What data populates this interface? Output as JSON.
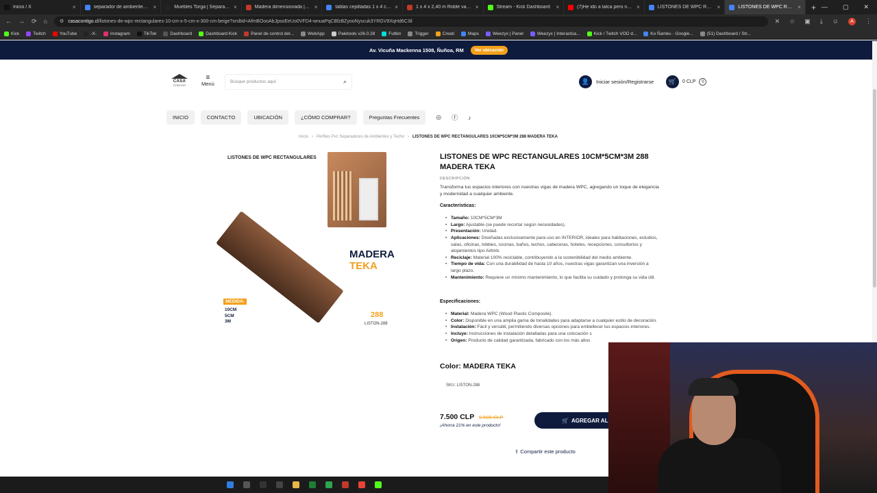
{
  "browser": {
    "tabs": [
      {
        "label": "Inicio / X",
        "color": "#111111"
      },
      {
        "label": "separador de ambientes - Bu",
        "color": "#4285f4"
      },
      {
        "label": "Muebles Torga | Separador d",
        "color": "#222222"
      },
      {
        "label": "Madera dimensionada | Sodi",
        "color": "#c0392b"
      },
      {
        "label": "tablas cepilladas 1 x 4 cepilla",
        "color": "#4285f4"
      },
      {
        "label": "1 x 4 x 2,40 m Roble vaporiz",
        "color": "#c0392b"
      },
      {
        "label": "Stream - Kick Dashboard",
        "color": "#53fc18"
      },
      {
        "label": "(7)He ido a talca pero no con",
        "color": "#ff0000"
      },
      {
        "label": "LISTONES DE WPC RECTANG",
        "color": "#4285f4"
      },
      {
        "label": "LISTONES DE WPC RECTANG",
        "color": "#4285f4"
      }
    ],
    "url_domain": "casacontigo.cl",
    "url_path": "/listones-de-wpc-rectangulares-10-cm-x-5-cm-x-300-cm-beige?srsltid=AfmBOooAbJpsoEeUo0VFD4-wnuaPqCBfzBZyooNyscuk3YRGV9XqHd6C3il",
    "bookmarks": [
      "Kick",
      "Twitch",
      "YouTube",
      "-X-",
      "Instagram",
      "TikTok",
      "Dashboard",
      "Dashboard Kick",
      "Panel de control del...",
      "WebApp",
      "Paletools v26.0.28",
      "Futbin",
      "Trigger",
      "Creati",
      "Maps",
      "Weezyx | Panel",
      "Weezyx | Interactúa...",
      "Kick / Twitch VOD d...",
      "Ko Ñamku - Google...",
      "(51) Dashboard / Str..."
    ]
  },
  "topbar": {
    "address": "Av. Vicuña Mackenna 1508, Ñuñoa, RM",
    "location_button": "Ver ubicación"
  },
  "header": {
    "logo_line1": "CASA",
    "logo_line2": "CONTIGO",
    "menu_label": "Menú",
    "search_placeholder": "Busque productos aquí",
    "login_label": "Iniciar sesión/Registrarse",
    "cart_total": "0 CLP",
    "cart_count": "0"
  },
  "nav": [
    "INICIO",
    "CONTACTO",
    "UBICACIÓN",
    "¿CÓMO COMPRAR?",
    "Preguntas Frecuentes"
  ],
  "breadcrumb": {
    "home": "Inicio",
    "category": "Perfiles Pvc Separadores de Ambientes y Techo",
    "current": "LISTONES DE WPC RECTANGULARES 10CM*5CM*3M 288 MADERA TEKA"
  },
  "product_image": {
    "title": "LISTONES DE WPC RECTANGULARES",
    "brand_word1": "MADERA",
    "brand_word2": "TEKA",
    "measure_label": "MEDIDA:",
    "dim1": "10CM",
    "dim2": "5CM",
    "dim3": "3M",
    "code_number": "288",
    "code_label": "LISTON-288"
  },
  "product": {
    "title": "LISTONES DE WPC RECTANGULARES 10CM*5CM*3M 288 MADERA TEKA",
    "description_heading": "DESCRIPCIÓN",
    "description": "Transforma tus espacios interiores con nuestras vigas de madera WPC, agregando un toque de elegancia y modernidad a cualquier ambiente.",
    "features_heading": "Características:",
    "features": [
      {
        "k": "Tamaño:",
        "v": "10CM*5CM*3M"
      },
      {
        "k": "Largo:",
        "v": "Ajustable (se puede recortar según necesidades)."
      },
      {
        "k": "Presentación:",
        "v": "Unidad."
      },
      {
        "k": "Aplicaciones:",
        "v": "Diseñadas exclusivamente para uso en INTERIOR, ideales para habitaciones, estudios, salas, oficinas, lobbies, cocinas, baños, techos, cabeceras, hoteles, recepciones, consultorios y alojamientos tipo Airbnb."
      },
      {
        "k": "Reciclaje:",
        "v": "Material 100% reciclable, contribuyendo a la sostenibilidad del medio ambiente."
      },
      {
        "k": "Tiempo de vida:",
        "v": "Con una durabilidad de hasta 10 años, nuestras vigas garantizan una inversión a largo plazo."
      },
      {
        "k": "Mantenimiento:",
        "v": "Requiere un mínimo mantenimiento, lo que facilita su cuidado y prolonga su vida útil."
      }
    ],
    "specs_heading": "Especificaciones:",
    "specs": [
      {
        "k": "Material:",
        "v": "Madera WPC (Wood Plastic Composite)."
      },
      {
        "k": "Color:",
        "v": "Disponible en una amplia gama de tonalidades para adaptarse a cualquier estilo de decoración."
      },
      {
        "k": "Instalación:",
        "v": "Fácil y versátil, permitiendo diversas opciones para embellecer tus espacios interiores."
      },
      {
        "k": "Incluye:",
        "v": "Instrucciones de instalación detalladas para una colocación s"
      },
      {
        "k": "Origen:",
        "v": "Producto de calidad garantizada, fabricado con los más altos"
      }
    ],
    "color_line": "Color: MADERA TEKA",
    "sku": "SKU: LISTON-288",
    "price": "7.500 CLP",
    "old_price": "9.500 CLP",
    "savings": "¡Ahorra 21% en este producto!",
    "add_button": "AGREGAR AL",
    "share": "Compartir este producto"
  },
  "colors": {
    "navy": "#0f1b3d",
    "accent": "#f2a01c"
  }
}
